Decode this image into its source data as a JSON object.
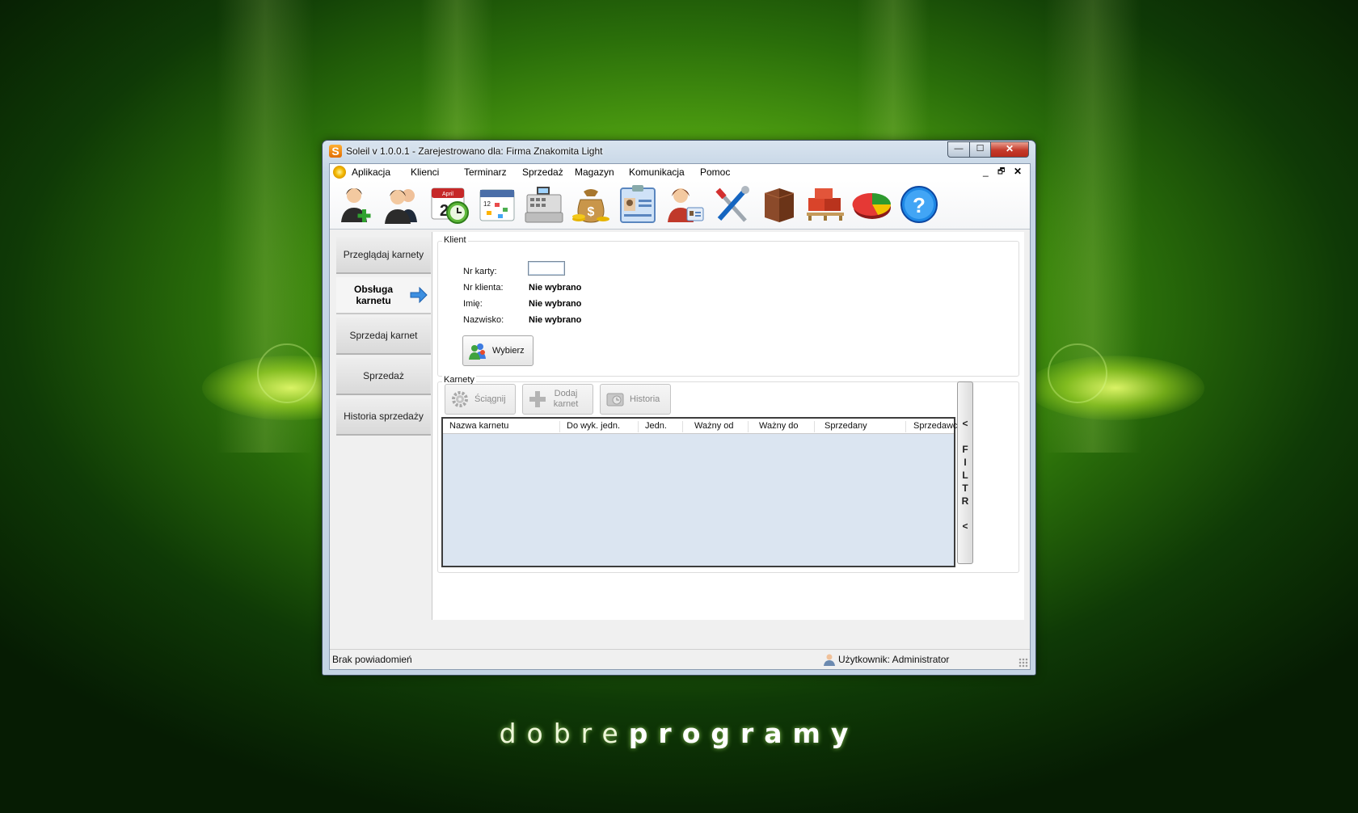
{
  "window": {
    "title": "Soleil v 1.0.0.1 - Zarejestrowano dla: Firma Znakomita Light",
    "app_logo_letter": "S",
    "controls": {
      "minimize": "—",
      "maximize": "☐",
      "close": "✕"
    }
  },
  "menu": {
    "items": [
      "Aplikacja",
      "Klienci",
      "Terminarz",
      "Sprzedaż",
      "Magazyn",
      "Komunikacja",
      "Pomoc"
    ],
    "mdi_controls": {
      "minimize": "_",
      "restore": "🗗",
      "close": "✕"
    }
  },
  "toolbar": {
    "icons": [
      "add-client-icon",
      "clients-icon",
      "calendar-icon",
      "schedule-icon",
      "cash-register-icon",
      "money-bag-icon",
      "id-card-icon",
      "employee-icon",
      "tools-icon",
      "warehouse-box-icon",
      "pallet-icon",
      "pie-chart-icon",
      "help-icon"
    ],
    "calendar_day": "2",
    "calendar_month": "April",
    "schedule_day": "12",
    "help_glyph": "?"
  },
  "sidebar": {
    "items": [
      {
        "label": "Przeglądaj karnety",
        "active": false
      },
      {
        "label": "Obsługa karnetu",
        "active": true
      },
      {
        "label": "Sprzedaj karnet",
        "active": false
      },
      {
        "label": "Sprzedaż",
        "active": false
      },
      {
        "label": "Historia sprzedaży",
        "active": false
      }
    ]
  },
  "klient": {
    "group_label": "Klient",
    "fields": [
      {
        "label": "Nr karty:",
        "value": ""
      },
      {
        "label": "Nr klienta:",
        "value": "Nie wybrano"
      },
      {
        "label": "Imię:",
        "value": "Nie wybrano"
      },
      {
        "label": "Nazwisko:",
        "value": "Nie wybrano"
      }
    ],
    "select_button": "Wybierz"
  },
  "karnety": {
    "group_label": "Karnety",
    "buttons": [
      {
        "label": "Ściągnij",
        "enabled": false
      },
      {
        "label": "Dodaj karnet",
        "enabled": false
      },
      {
        "label": "Historia",
        "enabled": false
      }
    ],
    "columns": [
      "Nazwa karnetu",
      "Do wyk. jedn.",
      "Jedn.",
      "Ważny od",
      "Ważny do",
      "Sprzedany",
      "Sprzedawca"
    ],
    "rows": [],
    "filter_label": [
      "<",
      "F",
      "I",
      "L",
      "T",
      "R",
      "<"
    ]
  },
  "status": {
    "notifications": "Brak powiadomień",
    "user": "Użytkownik: Administrator"
  },
  "branding": {
    "part1": "dobre",
    "part2": "programy"
  },
  "colors": {
    "grid_background": "#dbe5f1",
    "close_button": "#c4392a"
  }
}
